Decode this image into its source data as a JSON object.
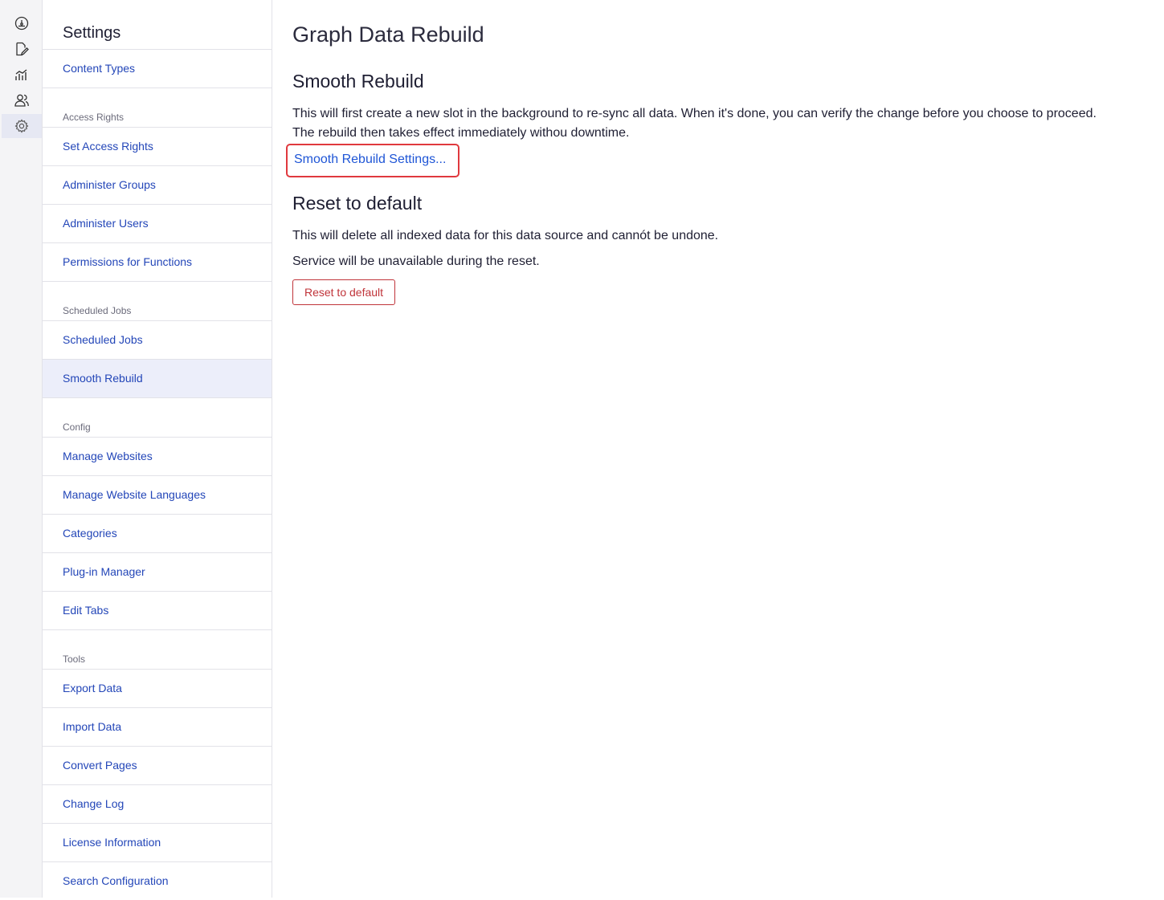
{
  "rail": {
    "items": [
      {
        "icon": "dashboard-icon"
      },
      {
        "icon": "edit-document-icon"
      },
      {
        "icon": "analytics-icon"
      },
      {
        "icon": "users-icon"
      },
      {
        "icon": "settings-gear-icon",
        "active": true
      }
    ]
  },
  "sidebar": {
    "title": "Settings",
    "items": [
      "Content Types",
      "Access Rights",
      "Set Access Rights",
      "Administer Groups",
      "Administer Users",
      "Permissions for Functions",
      "Scheduled Jobs",
      "Scheduled Jobs",
      "Smooth Rebuild",
      "Config",
      "Manage Websites",
      "Manage Website Languages",
      "Categories",
      "Plug-in Manager",
      "Edit Tabs",
      "Tools",
      "Export Data",
      "Import Data",
      "Convert Pages",
      "Change Log",
      "License Information",
      "Search Configuration"
    ],
    "active_item": "Smooth Rebuild"
  },
  "main": {
    "title": "Graph Data Rebuild",
    "smooth": {
      "heading": "Smooth Rebuild",
      "line1": "This will first create a new slot in the background to re-sync all data. When it's done, you can verify the change before you choose to proceed.",
      "line2": "The rebuild then takes effect immediately withou downtime.",
      "link": "Smooth Rebuild Settings..."
    },
    "reset": {
      "heading": "Reset to default",
      "line1": "This will delete all indexed data for this data source and cannót be undone.",
      "line2": "Service will be unavailable during the reset.",
      "button": "Reset to default"
    }
  },
  "colors": {
    "link": "#2346b8",
    "highlight_border": "#e0393e",
    "danger": "#c0343a",
    "active_bg": "#eceefa"
  }
}
